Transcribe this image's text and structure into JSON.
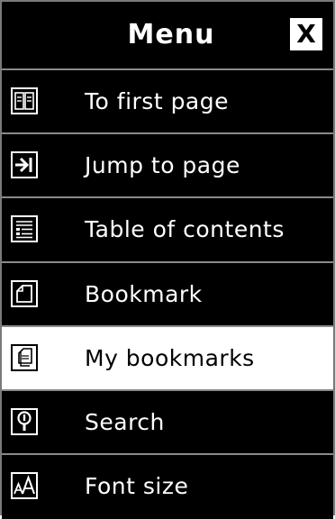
{
  "header": {
    "title": "Menu",
    "close_label": "X"
  },
  "items": [
    {
      "label": "To first page",
      "icon": "first-page-icon"
    },
    {
      "label": "Jump to page",
      "icon": "jump-to-page-icon"
    },
    {
      "label": "Table of contents",
      "icon": "table-of-contents-icon"
    },
    {
      "label": "Bookmark",
      "icon": "bookmark-icon"
    },
    {
      "label": "My bookmarks",
      "icon": "my-bookmarks-icon",
      "selected": true
    },
    {
      "label": "Search",
      "icon": "search-icon"
    },
    {
      "label": "Font size",
      "icon": "font-size-icon"
    }
  ],
  "colors": {
    "background": "#000000",
    "text": "#ffffff",
    "selected_background": "#ffffff",
    "selected_text": "#000000",
    "divider": "#8a8a8a"
  }
}
